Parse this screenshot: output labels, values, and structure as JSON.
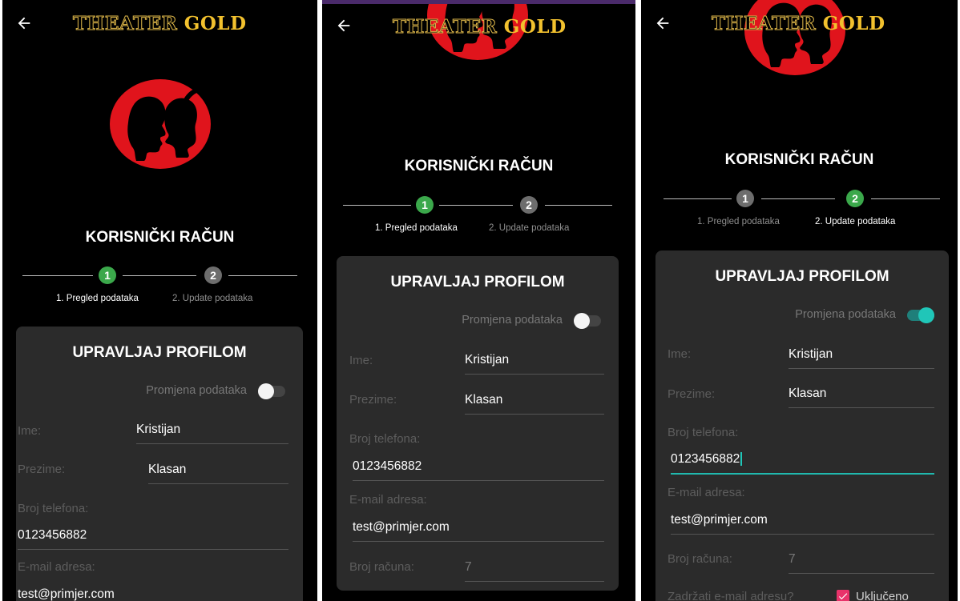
{
  "app": {
    "logo_part1": "THEATER",
    "logo_part2": "GOLD"
  },
  "screen": {
    "title": "KORISNIČKI RAČUN"
  },
  "stepper": {
    "step1_number": "1",
    "step1_label": "1. Pregled podataka",
    "step2_number": "2",
    "step2_label": "2. Update podataka"
  },
  "card": {
    "title": "UPRAVLJAJ PROFILOM",
    "toggle_label": "Promjena podataka",
    "fields": {
      "ime_label": "Ime:",
      "ime_value": "Kristijan",
      "prezime_label": "Prezime:",
      "prezime_value": "Klasan",
      "telefon_label": "Broj telefona:",
      "telefon_value": "0123456882",
      "email_label": "E-mail adresa:",
      "email_value": "test@primjer.com",
      "racun_label": "Broj računa:",
      "racun_value": "7",
      "zadrzati_label": "Zadržati e-mail adresu?",
      "ukljuceno_label": "Uključeno"
    }
  },
  "colors": {
    "accent_green": "#3ba84b",
    "accent_teal": "#20c6b8",
    "emblem_red": "#e0141c",
    "logo_gold": "#f2c12e"
  },
  "icons": [
    "back-arrow-icon",
    "theater-emblem-icon",
    "check-icon"
  ],
  "screens": [
    {
      "active_step": 1,
      "toggle_on": false
    },
    {
      "active_step": 1,
      "toggle_on": false
    },
    {
      "active_step": 2,
      "toggle_on": true
    }
  ]
}
